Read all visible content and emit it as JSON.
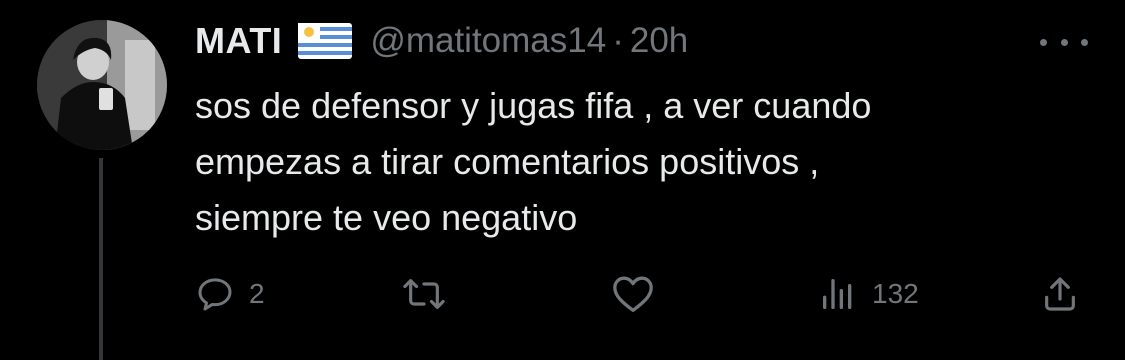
{
  "tweet": {
    "display_name": "MATI",
    "flag_emoji": "uruguay-flag",
    "handle": "@matitomas14",
    "separator": "·",
    "time": "20h",
    "text_lines": [
      "sos de defensor y jugas fifa , a ver cuando",
      "empezas a tirar comentarios positivos ,",
      "siempre te veo negativo"
    ],
    "actions": {
      "reply_count": "2",
      "retweet_count": "",
      "like_count": "",
      "views_count": "132"
    }
  },
  "icons": {
    "reply": "reply-icon",
    "retweet": "retweet-icon",
    "like": "heart-icon",
    "views": "views-icon",
    "share": "share-icon",
    "more": "more-icon"
  },
  "colors": {
    "background": "#000000",
    "text": "#e7e9ea",
    "secondary": "#71767b",
    "thread_line": "#333639"
  }
}
